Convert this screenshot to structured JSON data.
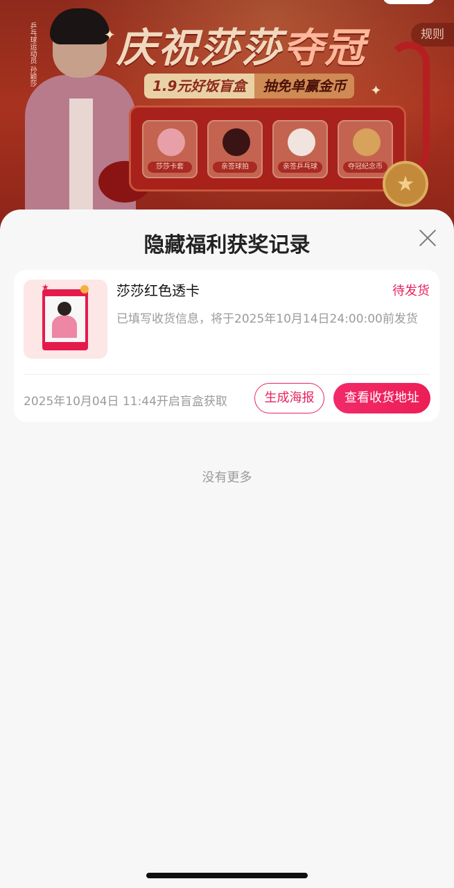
{
  "banner": {
    "title_part1": "庆祝莎莎",
    "title_part2": "夺冠",
    "rules": "规则",
    "promo_left": "1.9元好饭盲盒",
    "promo_right": "抽免单赢金币",
    "signature_text": "乒乓球运动员 孙颖莎",
    "prizes": [
      {
        "label": "莎莎卡套"
      },
      {
        "label": "亲签球拍"
      },
      {
        "label": "亲签乒乓球"
      },
      {
        "label": "夺冠纪念币"
      }
    ]
  },
  "sheet": {
    "title": "隐藏福利获奖记录",
    "empty_hint": "没有更多"
  },
  "records": [
    {
      "name": "莎莎红色透卡",
      "status": "待发货",
      "description": "已填写收货信息，将于2025年10月14日24:00:00前发货",
      "opened_time": "2025年10月04日 11:44开启盲盒获取",
      "poster_button": "生成海报",
      "address_button": "查看收货地址"
    }
  ],
  "colors": {
    "accent": "#e8225e",
    "banner_red": "#a8321f",
    "sheet_bg": "#f7f7f7"
  }
}
